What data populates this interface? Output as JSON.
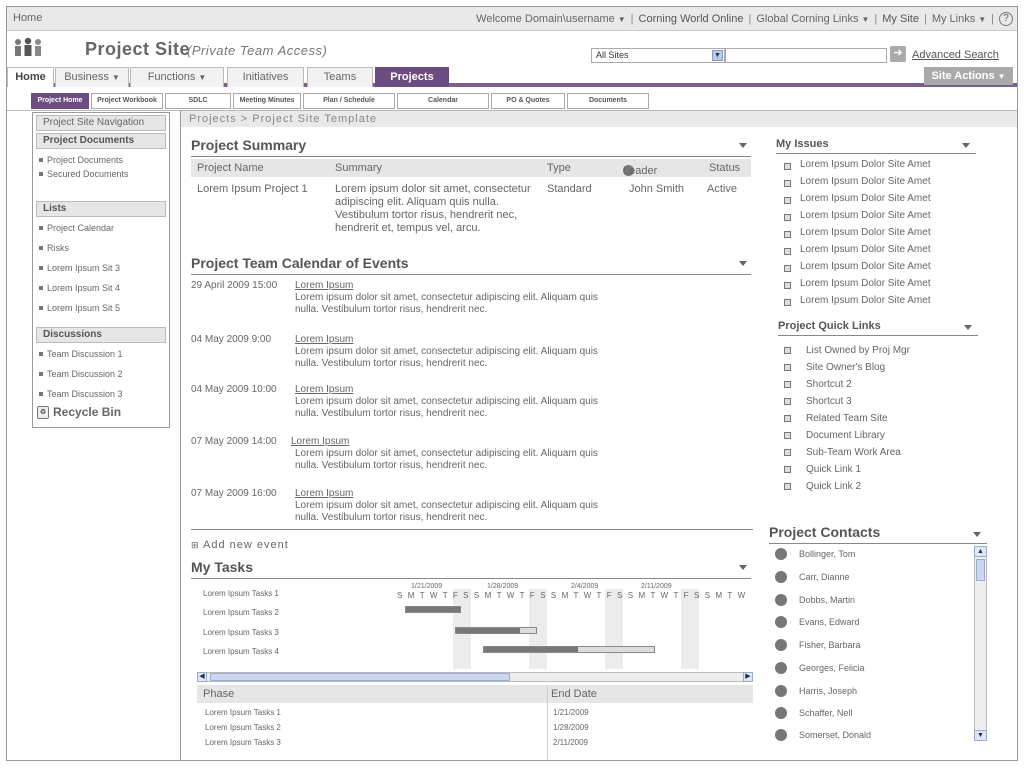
{
  "topbar": {
    "home": "Home",
    "welcome": "Welcome Domain\\username",
    "links": [
      "Corning World Online",
      "Global Corning Links",
      "My Site",
      "My Links"
    ]
  },
  "header": {
    "title": "Project Site",
    "subtitle": "(Private Team Access)",
    "scope_value": "All Sites",
    "search_value": "",
    "advanced_search": "Advanced Search"
  },
  "nav": {
    "tabs": [
      "Home",
      "Business",
      "Functions",
      "Initiatives",
      "Teams",
      "Projects"
    ],
    "site_actions": "Site Actions"
  },
  "subnav": {
    "tabs": [
      "Project Home",
      "Project Workbook",
      "SDLC",
      "Meeting Minutes",
      "Plan / Schedule",
      "Calendar",
      "PO & Quotes",
      "Documents"
    ]
  },
  "leftnav": {
    "title": "Project Site Navigation",
    "sections": [
      {
        "title": "Project Documents",
        "items": [
          "Project Documents",
          "Secured Documents"
        ]
      },
      {
        "title": "Lists",
        "items": [
          "Project Calendar",
          "Risks",
          "Lorem Ipsum Sit 3",
          "Lorem Ipsum Sit 4",
          "Lorem Ipsum Sit 5"
        ]
      },
      {
        "title": "Discussions",
        "items": [
          "Team Discussion 1",
          "Team Discussion 2",
          "Team Discussion 3"
        ]
      }
    ],
    "recycle_bin": "Recycle Bin"
  },
  "breadcrumb": "Projects > Project Site Template",
  "summary": {
    "title": "Project Summary",
    "columns": [
      "Project Name",
      "Summary",
      "Type",
      "Leader",
      "Status"
    ],
    "row": {
      "name": "Lorem Ipsum Project 1",
      "summary_lines": [
        "Lorem ipsum dolor sit amet, consectetur",
        "adipiscing elit. Aliquam quis nulla.",
        "Vestibulum tortor risus, hendrerit nec,",
        "hendrerit et, tempus vel, arcu."
      ],
      "type": "Standard",
      "leader": "John Smith",
      "status": "Active"
    }
  },
  "calendar": {
    "title": "Project Team Calendar of Events",
    "events": [
      {
        "date": "29 April 2009 15:00",
        "title": "Lorem Ipsum",
        "line1": "Lorem ipsum dolor sit amet, consectetur adipiscing elit. Aliquam quis",
        "line2": "nulla. Vestibulum tortor risus, hendrerit nec."
      },
      {
        "date": "04 May 2009  9:00",
        "title": "Lorem Ipsum",
        "line1": "Lorem ipsum dolor sit amet, consectetur adipiscing elit. Aliquam quis",
        "line2": "nulla. Vestibulum tortor risus, hendrerit nec."
      },
      {
        "date": "04 May 2009 10:00",
        "title": "Lorem Ipsum",
        "line1": "Lorem ipsum dolor sit amet, consectetur adipiscing elit. Aliquam quis",
        "line2": "nulla. Vestibulum tortor risus, hendrerit nec."
      },
      {
        "date": "07 May 2009 14:00",
        "title": "Lorem Ipsum",
        "line1": "Lorem ipsum dolor sit amet, consectetur adipiscing elit. Aliquam quis",
        "line2": "nulla. Vestibulum tortor risus, hendrerit nec."
      },
      {
        "date": "07 May 2009 16:00",
        "title": "Lorem Ipsum",
        "line1": "Lorem ipsum dolor sit amet, consectetur adipiscing elit. Aliquam quis",
        "line2": "nulla. Vestibulum tortor risus, hendrerit nec."
      }
    ],
    "add_event": "Add new event"
  },
  "tasks": {
    "title": "My Tasks",
    "task_names": [
      "Lorem Ipsum Tasks 1",
      "Lorem Ipsum Tasks 2",
      "Lorem Ipsum Tasks 3",
      "Lorem Ipsum Tasks 4"
    ],
    "week_dates": [
      "1/21/2009",
      "1/28/2009",
      "2/4/2009",
      "2/11/2009"
    ],
    "day_letters": "S M T W T F S S M T W T F S S M T W T F S S M T W T F S S M T W",
    "phase_columns": [
      "Phase",
      "End Date"
    ],
    "phase_rows": [
      {
        "phase": "Lorem Ipsum Tasks 1",
        "end": "1/21/2009"
      },
      {
        "phase": "Lorem Ipsum Tasks 2",
        "end": "1/28/2009"
      },
      {
        "phase": "Lorem Ipsum Tasks 3",
        "end": "2/11/2009"
      }
    ]
  },
  "issues": {
    "title": "My Issues",
    "items": [
      "Lorem Ipsum Dolor Site Amet",
      "Lorem Ipsum Dolor Site Amet",
      "Lorem Ipsum Dolor Site Amet",
      "Lorem Ipsum Dolor Site Amet",
      "Lorem Ipsum Dolor Site Amet",
      "Lorem Ipsum Dolor Site Amet",
      "Lorem Ipsum Dolor Site Amet",
      "Lorem Ipsum Dolor Site Amet",
      "Lorem Ipsum Dolor Site Amet"
    ]
  },
  "quicklinks": {
    "title": "Project Quick Links",
    "items": [
      "List Owned by Proj Mgr",
      "Site Owner's Blog",
      "Shortcut 2",
      "Shortcut 3",
      "Related Team Site",
      "Document Library",
      "Sub-Team Work Area",
      "Quick Link 1",
      "Quick Link 2"
    ]
  },
  "contacts": {
    "title": "Project Contacts",
    "items": [
      "Bollinger, Tom",
      "Carr, Dianne",
      "Dobbs, Martin",
      "Evans, Edward",
      "Fisher, Barbara",
      "Georges, Felicia",
      "Harris, Joseph",
      "Schaffer, Nell",
      "Somerset, Donald"
    ]
  },
  "colors": {
    "accent": "#6c4d82",
    "header_gray": "#e9e9e9"
  }
}
